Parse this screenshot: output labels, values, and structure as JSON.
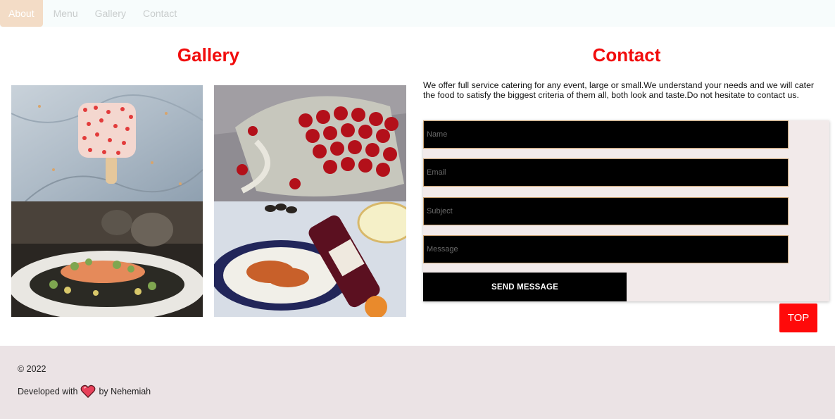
{
  "nav": {
    "items": [
      {
        "label": "About",
        "active": true
      },
      {
        "label": "Menu",
        "active": false
      },
      {
        "label": "Gallery",
        "active": false
      },
      {
        "label": "Contact",
        "active": false
      }
    ]
  },
  "gallery": {
    "title": "Gallery",
    "images": [
      "popsicle-photo",
      "cherries-photo",
      "salmon-dish-photo",
      "pasta-wine-photo"
    ]
  },
  "contact": {
    "title": "Contact",
    "text": "We offer full service catering for any event, large or small.We understand your needs and we will cater the food to satisfy the biggest criteria of them all, both look and taste.Do not hesitate to contact us.",
    "form": {
      "name_placeholder": "Name",
      "email_placeholder": "Email",
      "subject_placeholder": "Subject",
      "message_placeholder": "Message",
      "send_label": "SEND MESSAGE"
    }
  },
  "top_button": "TOP",
  "footer": {
    "copyright": "© 2022",
    "developed_prefix": "Developed with",
    "developed_suffix": "by Nehemiah"
  },
  "colors": {
    "accent_red": "#f10d0d",
    "nav_active": "#f3dcc6",
    "footer_bg": "#ebe3e5",
    "form_bg": "#f2eaea"
  }
}
